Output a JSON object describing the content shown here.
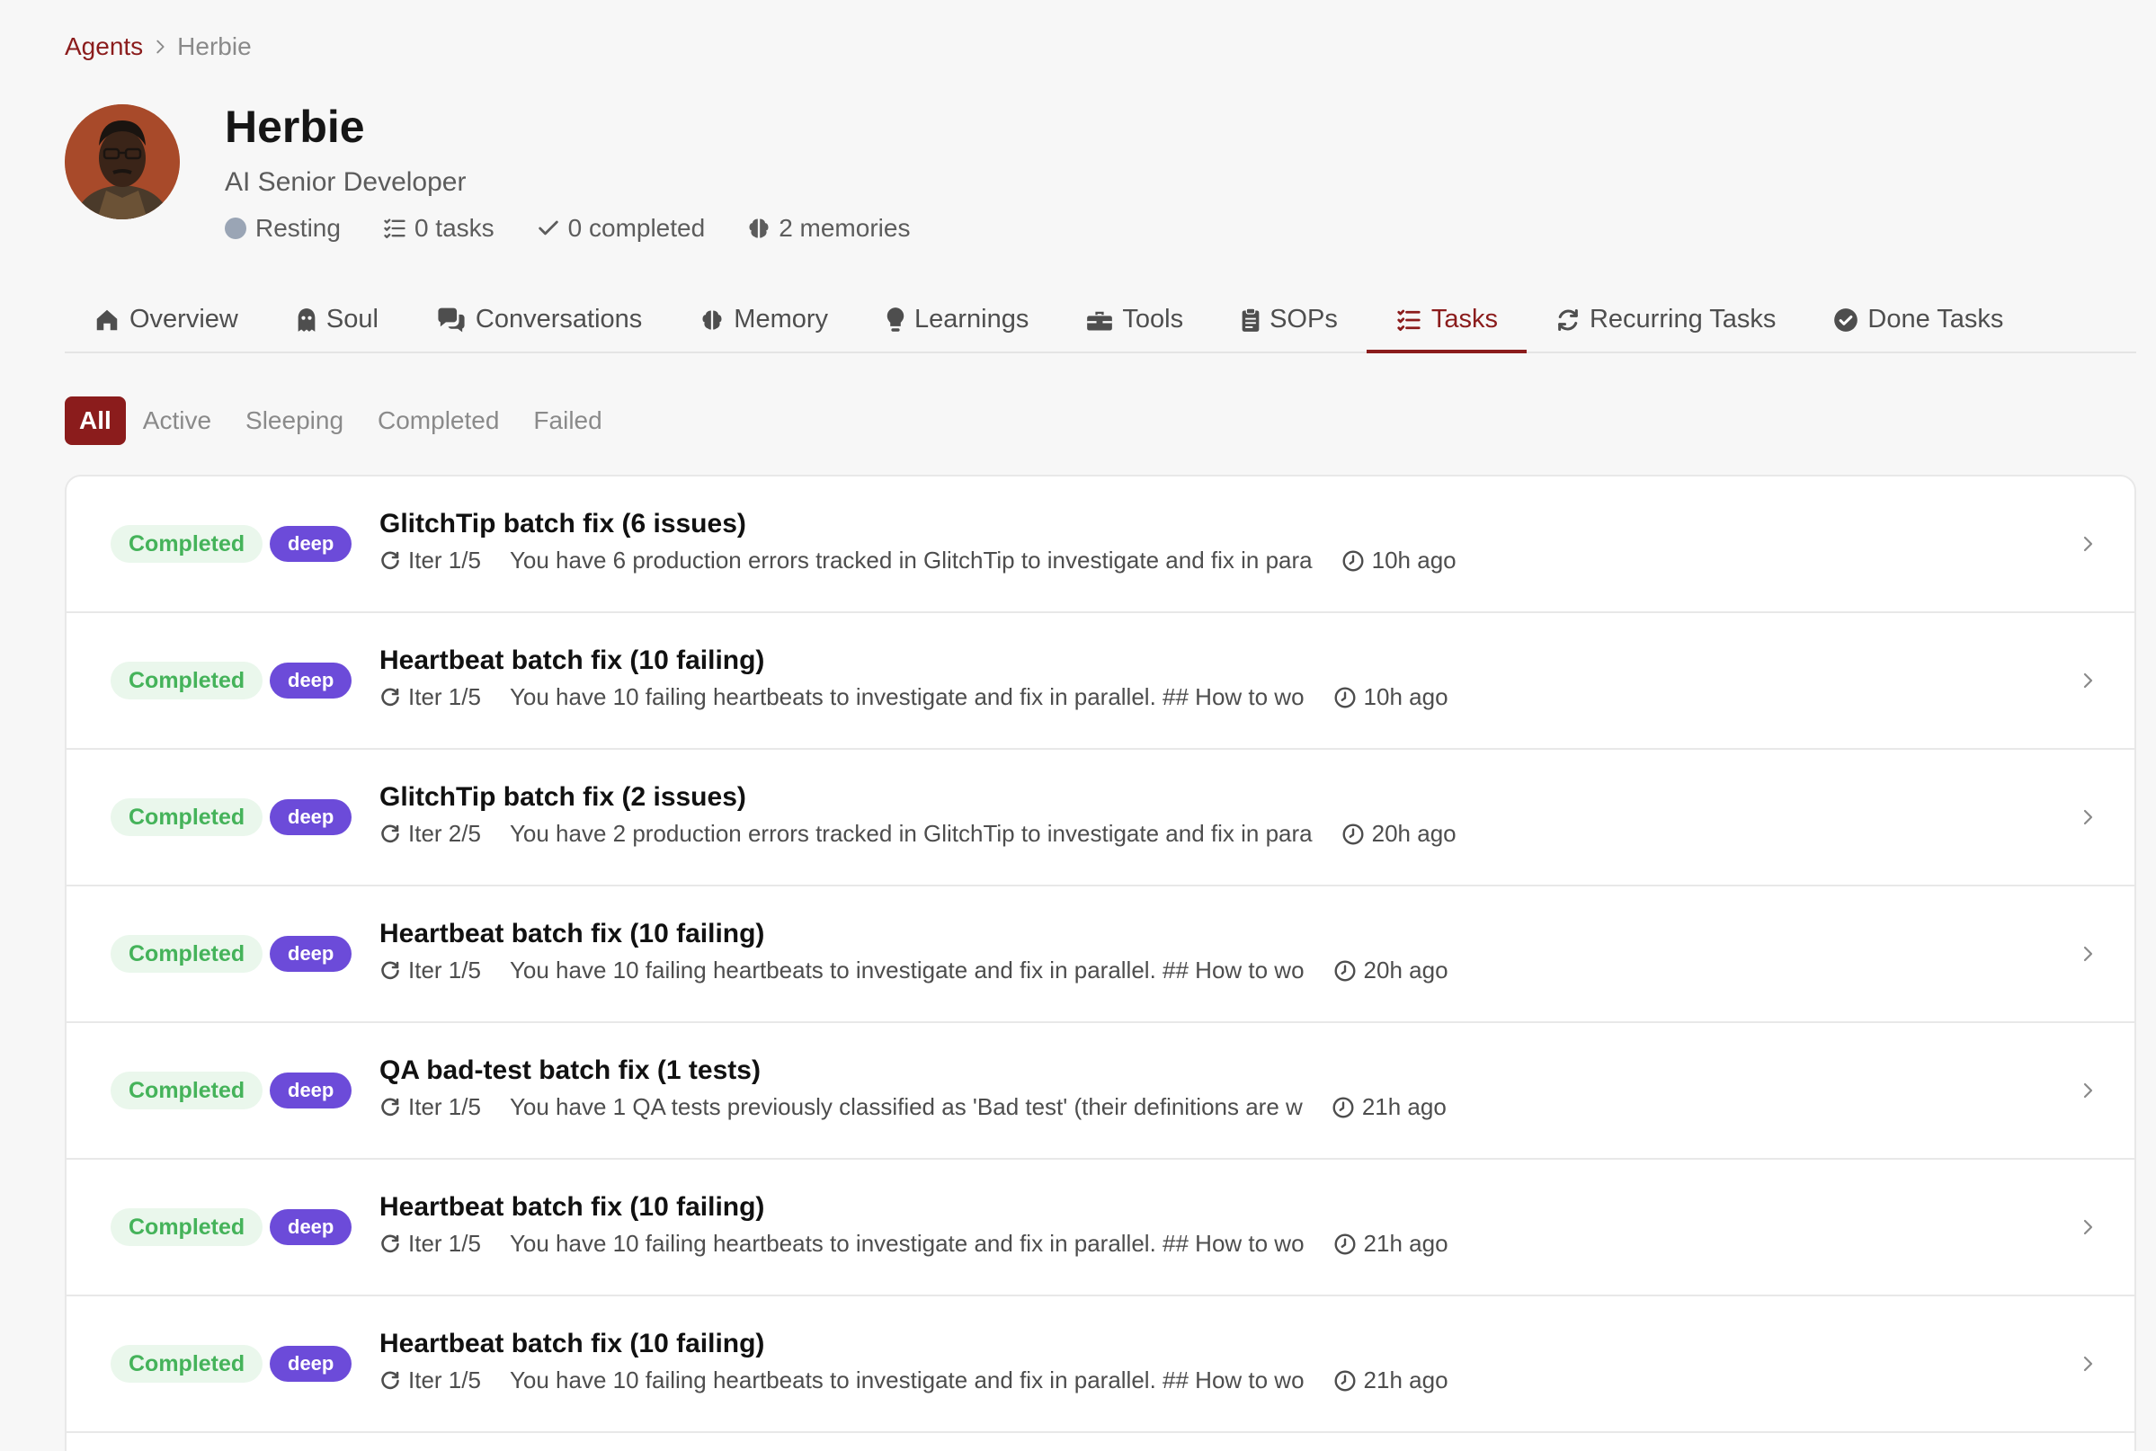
{
  "breadcrumb": {
    "parent": "Agents",
    "current": "Herbie"
  },
  "agent": {
    "name": "Herbie",
    "role": "AI Senior Developer",
    "stats": {
      "status": "Resting",
      "tasks": "0 tasks",
      "completed": "0 completed",
      "memories": "2 memories"
    }
  },
  "tabs": [
    {
      "label": "Overview",
      "icon": "home-icon"
    },
    {
      "label": "Soul",
      "icon": "ghost-icon"
    },
    {
      "label": "Conversations",
      "icon": "comments-icon"
    },
    {
      "label": "Memory",
      "icon": "brain-icon"
    },
    {
      "label": "Learnings",
      "icon": "lightbulb-icon"
    },
    {
      "label": "Tools",
      "icon": "toolbox-icon"
    },
    {
      "label": "SOPs",
      "icon": "clipboard-icon"
    },
    {
      "label": "Tasks",
      "icon": "list-check-icon",
      "active": true
    },
    {
      "label": "Recurring Tasks",
      "icon": "refresh-icon"
    },
    {
      "label": "Done Tasks",
      "icon": "check-circle-icon"
    }
  ],
  "filters": [
    "All",
    "Active",
    "Sleeping",
    "Completed",
    "Failed"
  ],
  "active_filter": "All",
  "tasks": [
    {
      "status": "Completed",
      "mode": "deep",
      "title": "GlitchTip batch fix (6 issues)",
      "iter": "Iter 1/5",
      "desc": "You have 6 production errors tracked in GlitchTip to investigate and fix in para",
      "time": "10h ago"
    },
    {
      "status": "Completed",
      "mode": "deep",
      "title": "Heartbeat batch fix (10 failing)",
      "iter": "Iter 1/5",
      "desc": "You have 10 failing heartbeats to investigate and fix in parallel. ## How to wo",
      "time": "10h ago"
    },
    {
      "status": "Completed",
      "mode": "deep",
      "title": "GlitchTip batch fix (2 issues)",
      "iter": "Iter 2/5",
      "desc": "You have 2 production errors tracked in GlitchTip to investigate and fix in para",
      "time": "20h ago"
    },
    {
      "status": "Completed",
      "mode": "deep",
      "title": "Heartbeat batch fix (10 failing)",
      "iter": "Iter 1/5",
      "desc": "You have 10 failing heartbeats to investigate and fix in parallel. ## How to wo",
      "time": "20h ago"
    },
    {
      "status": "Completed",
      "mode": "deep",
      "title": "QA bad-test batch fix (1 tests)",
      "iter": "Iter 1/5",
      "desc": "You have 1 QA tests previously classified as 'Bad test' (their definitions are w",
      "time": "21h ago"
    },
    {
      "status": "Completed",
      "mode": "deep",
      "title": "Heartbeat batch fix (10 failing)",
      "iter": "Iter 1/5",
      "desc": "You have 10 failing heartbeats to investigate and fix in parallel. ## How to wo",
      "time": "21h ago"
    },
    {
      "status": "Completed",
      "mode": "deep",
      "title": "Heartbeat batch fix (10 failing)",
      "iter": "Iter 1/5",
      "desc": "You have 10 failing heartbeats to investigate and fix in parallel. ## How to wo",
      "time": "21h ago"
    }
  ],
  "colors": {
    "accent": "#8b1c1c",
    "completed_text": "#45b35a",
    "completed_bg": "#eaf7ec",
    "deep_badge": "#6c4bd9",
    "resting_dot": "#9aa5b5"
  }
}
